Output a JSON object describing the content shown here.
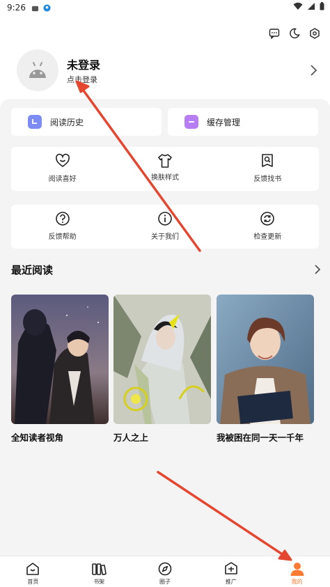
{
  "status_bar": {
    "time": "9:26"
  },
  "profile": {
    "name": "未登录",
    "subtitle": "点击登录"
  },
  "quick_actions": [
    {
      "label": "阅读历史",
      "color": "#7d8cf5"
    },
    {
      "label": "缓存管理",
      "color": "#b77df2"
    }
  ],
  "grid_row1": [
    {
      "label": "阅读喜好",
      "icon": "heart-smile-icon"
    },
    {
      "label": "换肤样式",
      "icon": "tshirt-icon"
    },
    {
      "label": "反馈找书",
      "icon": "book-search-icon"
    }
  ],
  "grid_row2": [
    {
      "label": "反馈帮助",
      "icon": "question-circle-icon"
    },
    {
      "label": "关于我们",
      "icon": "info-circle-icon"
    },
    {
      "label": "检查更新",
      "icon": "refresh-circle-icon"
    }
  ],
  "recent": {
    "title": "最近阅读",
    "books": [
      {
        "title": "全知读者视角"
      },
      {
        "title": "万人之上"
      },
      {
        "title": "我被困在同一天一千年"
      }
    ]
  },
  "tabbar": {
    "tabs": [
      {
        "label": "首页",
        "icon": "home-icon"
      },
      {
        "label": "书架",
        "icon": "bookshelf-icon"
      },
      {
        "label": "圈子",
        "icon": "compass-icon"
      },
      {
        "label": "推广",
        "icon": "promote-icon"
      },
      {
        "label": "我的",
        "icon": "profile-icon"
      }
    ],
    "active_color": "#ff7a33"
  },
  "annotation_color": "#e5462f"
}
